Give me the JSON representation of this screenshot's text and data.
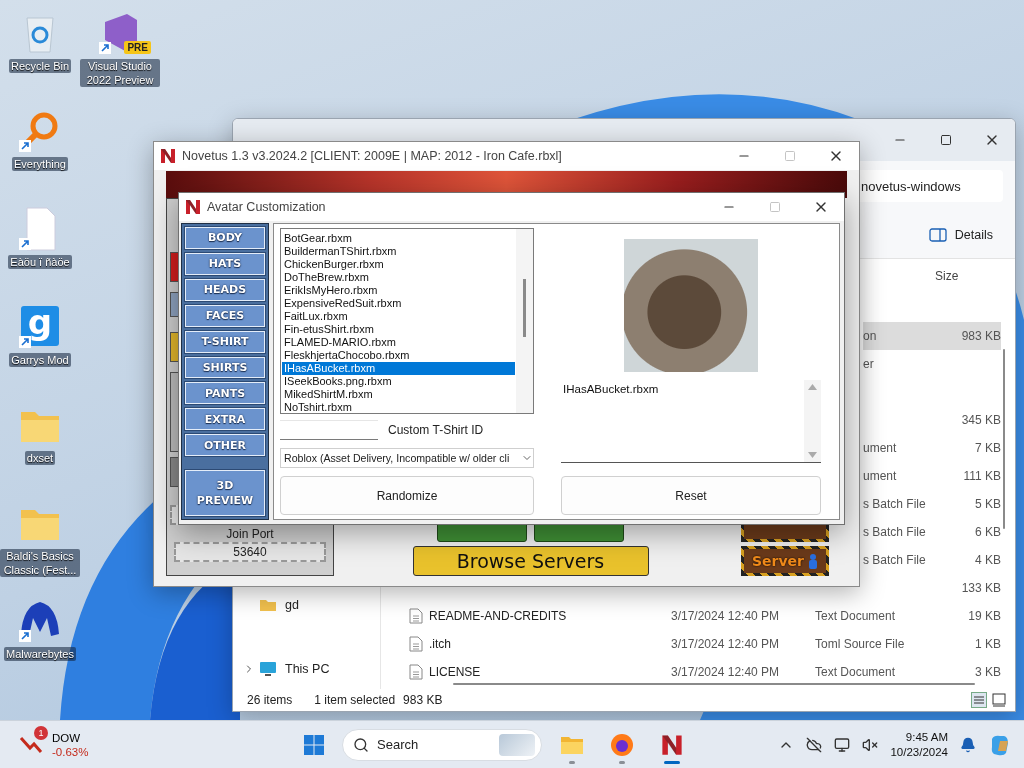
{
  "desktop_icons": {
    "column_1": [
      {
        "label": "Recycle Bin",
        "kind": "recycle",
        "shortcut": false
      },
      {
        "label": "Everything",
        "kind": "everything",
        "shortcut": true
      },
      {
        "label": "Eàöu ï ñàöe",
        "kind": "document",
        "shortcut": true
      },
      {
        "label": "Garrys Mod",
        "kind": "gmod",
        "shortcut": true,
        "glyph": "g"
      },
      {
        "label": "dxset",
        "kind": "folder",
        "shortcut": false
      },
      {
        "label": "Baldi's Basics Classic (Fest...",
        "kind": "folder",
        "shortcut": false
      },
      {
        "label": "Malwarebytes",
        "kind": "malwarebytes",
        "shortcut": true
      }
    ],
    "column_2": [
      {
        "label": "Visual Studio 2022 Preview",
        "kind": "vs",
        "shortcut": true,
        "badge": "PRE"
      }
    ]
  },
  "explorer": {
    "breadcrumb": "novetus-windows",
    "details_button": "Details",
    "columns": [
      "Size"
    ],
    "rows": [
      {
        "kind": "partial",
        "selected": true,
        "type": "on",
        "size": "983 KB"
      },
      {
        "kind": "partial",
        "selected": false,
        "type": "er"
      },
      {
        "kind": "partial",
        "selected": false
      },
      {
        "kind": "partial",
        "selected": false,
        "size": "345 KB"
      },
      {
        "kind": "partial",
        "selected": false,
        "type": "ument",
        "size": "7 KB"
      },
      {
        "kind": "partial",
        "selected": false,
        "type": "ument",
        "size": "111 KB"
      },
      {
        "kind": "partial",
        "selected": false,
        "type": "s Batch File",
        "size": "5 KB"
      },
      {
        "kind": "partial",
        "selected": false,
        "type": "s Batch File",
        "size": "6 KB"
      },
      {
        "kind": "partial",
        "selected": false,
        "type": "s Batch File",
        "size": "4 KB"
      },
      {
        "kind": "partial",
        "selected": false,
        "size": "133 KB"
      },
      {
        "kind": "full",
        "selected": false,
        "name": "README-AND-CREDITS",
        "date": "3/17/2024 12:40 PM",
        "type": "Text Document",
        "size": "19 KB"
      },
      {
        "kind": "full",
        "selected": false,
        "name": ".itch",
        "date": "3/17/2024 12:40 PM",
        "type": "Toml Source File",
        "size": "1 KB"
      },
      {
        "kind": "full",
        "selected": false,
        "name": "LICENSE",
        "date": "3/17/2024 12:40 PM",
        "type": "Text Document",
        "size": "3 KB"
      }
    ],
    "sidebar": [
      {
        "label": "gd",
        "kind": "folder"
      },
      {
        "label": "This PC",
        "kind": "pc"
      }
    ],
    "status": {
      "count": "26 items",
      "selection": "1 item selected",
      "size": "983 KB"
    }
  },
  "novetus": {
    "title": "Novetus 1.3 v3.2024.2 [CLIENT: 2009E | MAP: 2012 - Iron Cafe.rbxl]",
    "join_port_label": "Join Port",
    "join_port": "53640",
    "browse_button": "Browse Servers",
    "server_button": "Server"
  },
  "dialog": {
    "title": "Avatar Customization",
    "categories": [
      {
        "label": "BODY",
        "kind": "category"
      },
      {
        "label": "HATS",
        "kind": "category"
      },
      {
        "label": "HEADS",
        "kind": "category"
      },
      {
        "label": "FACES",
        "kind": "category"
      },
      {
        "label": "T-SHIRT",
        "kind": "category"
      },
      {
        "label": "SHIRTS",
        "kind": "category"
      },
      {
        "label": "PANTS",
        "kind": "category"
      },
      {
        "label": "EXTRA",
        "kind": "category"
      },
      {
        "label": "OTHER",
        "kind": "category"
      },
      {
        "label": "3D PREVIEW",
        "kind": "preview"
      }
    ],
    "items": [
      {
        "label": "BotGear.rbxm",
        "selected": false
      },
      {
        "label": "BuildermanTShirt.rbxm",
        "selected": false
      },
      {
        "label": "ChickenBurger.rbxm",
        "selected": false
      },
      {
        "label": "DoTheBrew.rbxm",
        "selected": false
      },
      {
        "label": "ErikIsMyHero.rbxm",
        "selected": false
      },
      {
        "label": "ExpensiveRedSuit.rbxm",
        "selected": false
      },
      {
        "label": "FaitLux.rbxm",
        "selected": false
      },
      {
        "label": "Fin-etusShirt.rbxm",
        "selected": false
      },
      {
        "label": "FLAMED-MARIO.rbxm",
        "selected": false
      },
      {
        "label": "FleskhjertaChocobo.rbxm",
        "selected": false
      },
      {
        "label": "IHasABucket.rbxm",
        "selected": true
      },
      {
        "label": "ISeekBooks.png.rbxm",
        "selected": false
      },
      {
        "label": "MikedShirtM.rbxm",
        "selected": false
      },
      {
        "label": "NoTshirt.rbxm",
        "selected": false
      }
    ],
    "custom_id_label": "Custom T-Shirt ID",
    "source": "Roblox (Asset Delivery, Incompatible w/ older cli",
    "randomize_button": "Randomize",
    "preview_text": "IHasABucket.rbxm",
    "reset_button": "Reset"
  },
  "taskbar": {
    "stock": {
      "badge": "1",
      "name": "DOW",
      "change": "-0.63%"
    },
    "search_placeholder": "Search",
    "apps": [
      {
        "kind": "explorer",
        "selected": false
      },
      {
        "kind": "firefox",
        "selected": false
      },
      {
        "kind": "novetus",
        "selected": true
      }
    ],
    "time": "9:45 AM",
    "date": "10/23/2024"
  }
}
